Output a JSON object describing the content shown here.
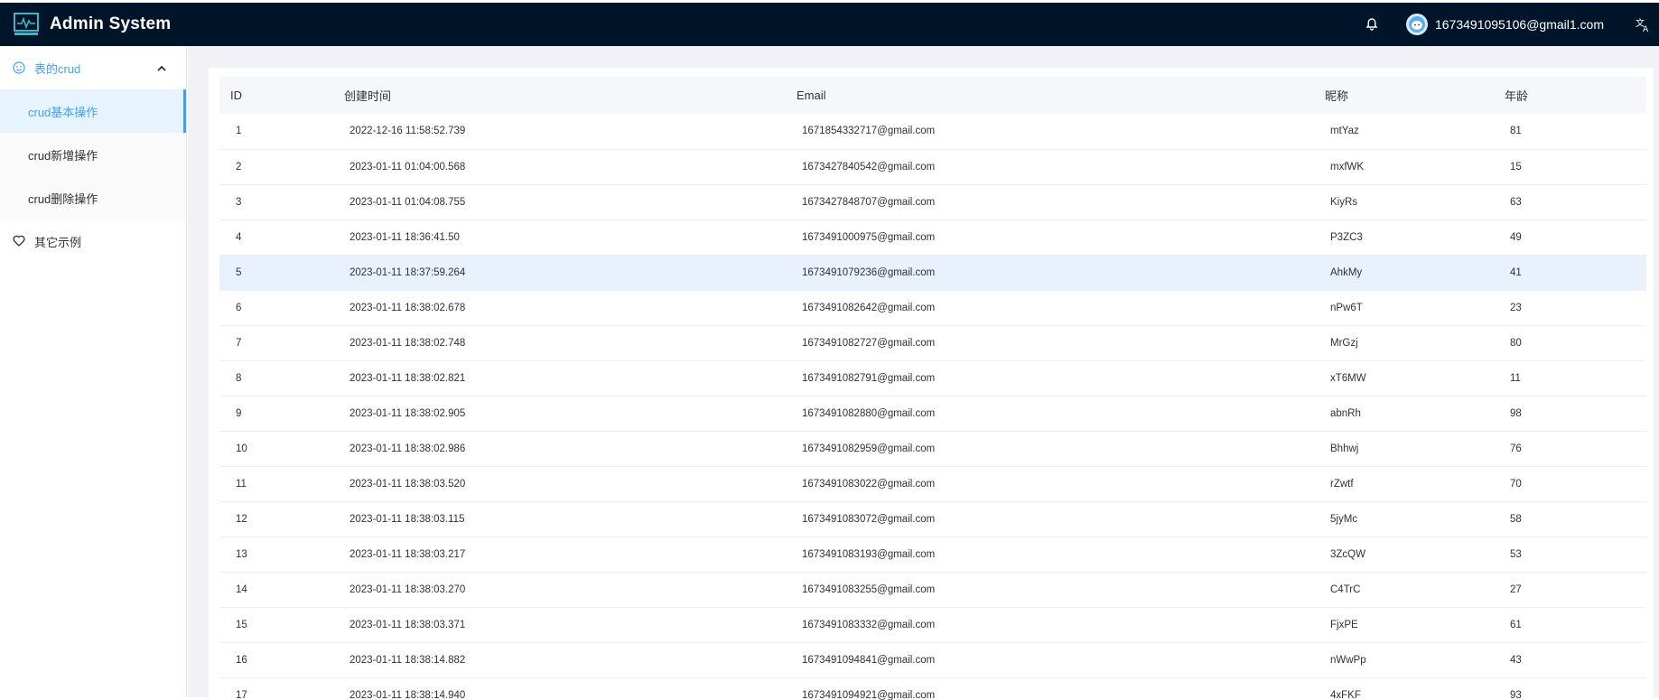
{
  "header": {
    "app_title": "Admin System",
    "user_email": "1673491095106@gmail1.com"
  },
  "sidebar": {
    "group": {
      "label": "表的crud",
      "expanded": true
    },
    "sub_items": [
      {
        "label": "crud基本操作",
        "active": true
      },
      {
        "label": "crud新增操作",
        "active": false
      },
      {
        "label": "crud删除操作",
        "active": false
      }
    ],
    "other": {
      "label": "其它示例"
    }
  },
  "table": {
    "columns": [
      "ID",
      "创建时间",
      "Email",
      "昵称",
      "年龄"
    ],
    "highlighted_row": 4,
    "rows": [
      [
        "1",
        "2022-12-16 11:58:52.739",
        "1671854332717@gmail.com",
        "mtYaz",
        "81"
      ],
      [
        "2",
        "2023-01-11 01:04:00.568",
        "1673427840542@gmail.com",
        "mxfWK",
        "15"
      ],
      [
        "3",
        "2023-01-11 01:04:08.755",
        "1673427848707@gmail.com",
        "KiyRs",
        "63"
      ],
      [
        "4",
        "2023-01-11 18:36:41.50",
        "1673491000975@gmail.com",
        "P3ZC3",
        "49"
      ],
      [
        "5",
        "2023-01-11 18:37:59.264",
        "1673491079236@gmail.com",
        "AhkMy",
        "41"
      ],
      [
        "6",
        "2023-01-11 18:38:02.678",
        "1673491082642@gmail.com",
        "nPw6T",
        "23"
      ],
      [
        "7",
        "2023-01-11 18:38:02.748",
        "1673491082727@gmail.com",
        "MrGzj",
        "80"
      ],
      [
        "8",
        "2023-01-11 18:38:02.821",
        "1673491082791@gmail.com",
        "xT6MW",
        "11"
      ],
      [
        "9",
        "2023-01-11 18:38:02.905",
        "1673491082880@gmail.com",
        "abnRh",
        "98"
      ],
      [
        "10",
        "2023-01-11 18:38:02.986",
        "1673491082959@gmail.com",
        "Bhhwj",
        "76"
      ],
      [
        "11",
        "2023-01-11 18:38:03.520",
        "1673491083022@gmail.com",
        "rZwtf",
        "70"
      ],
      [
        "12",
        "2023-01-11 18:38:03.115",
        "1673491083072@gmail.com",
        "5jyMc",
        "58"
      ],
      [
        "13",
        "2023-01-11 18:38:03.217",
        "1673491083193@gmail.com",
        "3ZcQW",
        "53"
      ],
      [
        "14",
        "2023-01-11 18:38:03.270",
        "1673491083255@gmail.com",
        "C4TrC",
        "27"
      ],
      [
        "15",
        "2023-01-11 18:38:03.371",
        "1673491083332@gmail.com",
        "FjxPE",
        "61"
      ],
      [
        "16",
        "2023-01-11 18:38:14.882",
        "1673491094841@gmail.com",
        "nWwPp",
        "43"
      ],
      [
        "17",
        "2023-01-11 18:38:14.940",
        "1673491094921@gmail.com",
        "4xFKF",
        "93"
      ]
    ]
  },
  "colors": {
    "header_bg": "#001529",
    "accent": "#409eff",
    "active_bg": "#e6f4ff",
    "highlight_row": "#e8f1fc",
    "content_bg": "#f0f2f5"
  },
  "icons": {
    "logo": "activity-monitor-icon",
    "bell": "bell-icon",
    "avatar": "user-avatar-icon",
    "lang": "translate-icon",
    "group": "smile-icon",
    "chevron": "chevron-up-icon",
    "other": "heart-icon"
  }
}
